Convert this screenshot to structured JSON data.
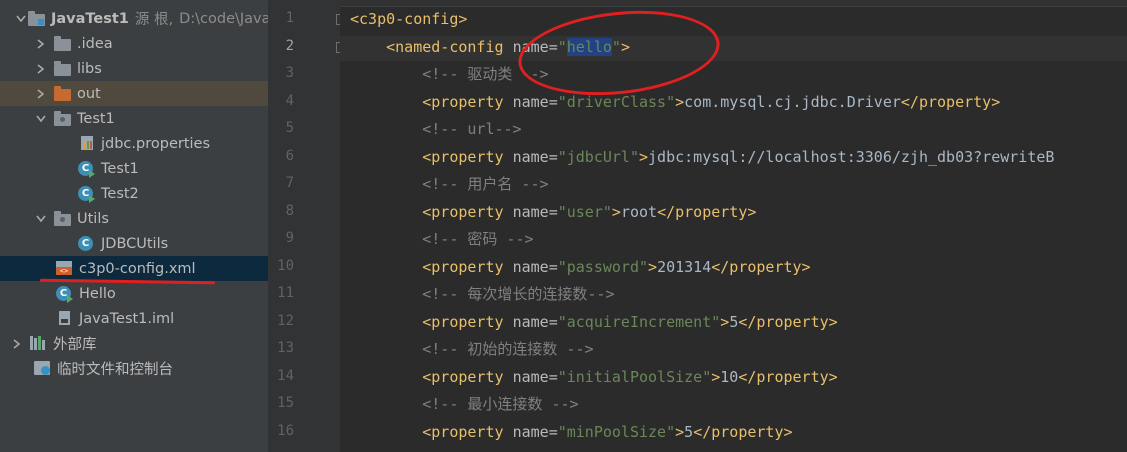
{
  "project_tree": {
    "rows": [
      {
        "label": "JavaTest1",
        "suffix": "源 根,",
        "path": "D:\\code\\Java"
      },
      {
        "label": ".idea"
      },
      {
        "label": "libs"
      },
      {
        "label": "out"
      },
      {
        "label": "Test1"
      },
      {
        "label": "jdbc.properties"
      },
      {
        "label": "Test1"
      },
      {
        "label": "Test2"
      },
      {
        "label": "Utils"
      },
      {
        "label": "JDBCUtils"
      },
      {
        "label": "c3p0-config.xml"
      },
      {
        "label": "Hello"
      },
      {
        "label": "JavaTest1.iml"
      },
      {
        "label": "外部库"
      },
      {
        "label": "临时文件和控制台"
      }
    ]
  },
  "editor": {
    "file": "c3p0-config.xml",
    "current_line": 2,
    "line_numbers": [
      "1",
      "2",
      "3",
      "4",
      "5",
      "6",
      "7",
      "8",
      "9",
      "10",
      "11",
      "12",
      "13",
      "14",
      "15",
      "16"
    ],
    "lines": [
      {
        "tag_open": "<c3p0-config>"
      },
      {
        "tag_open": "<named-config",
        "attr": "name",
        "value": "hello",
        "tag_close": ">"
      },
      {
        "comment": "<!-- 驱动类 -->"
      },
      {
        "tag_open": "<property",
        "attr": "name",
        "value": "driverClass",
        "text": "com.mysql.cj.jdbc.Driver",
        "end": "</property>"
      },
      {
        "comment": "<!-- url-->"
      },
      {
        "tag_open": "<property",
        "attr": "name",
        "value": "jdbcUrl",
        "text": "jdbc:mysql://localhost:3306/zjh_db03?rewriteB"
      },
      {
        "comment": "<!-- 用户名 -->"
      },
      {
        "tag_open": "<property",
        "attr": "name",
        "value": "user",
        "text": "root",
        "end": "</property>"
      },
      {
        "comment": "<!-- 密码 -->"
      },
      {
        "tag_open": "<property",
        "attr": "name",
        "value": "password",
        "text": "201314",
        "end": "</property>"
      },
      {
        "comment": "<!-- 每次增长的连接数-->"
      },
      {
        "tag_open": "<property",
        "attr": "name",
        "value": "acquireIncrement",
        "text": "5",
        "end": "</property>"
      },
      {
        "comment": "<!-- 初始的连接数 -->"
      },
      {
        "tag_open": "<property",
        "attr": "name",
        "value": "initialPoolSize",
        "text": "10",
        "end": "</property>"
      },
      {
        "comment": "<!-- 最小连接数 -->"
      },
      {
        "tag_open": "<property",
        "attr": "name",
        "value": "minPoolSize",
        "text": "5",
        "end": "</property>"
      }
    ]
  },
  "annotations": {
    "color": "#e02020"
  }
}
